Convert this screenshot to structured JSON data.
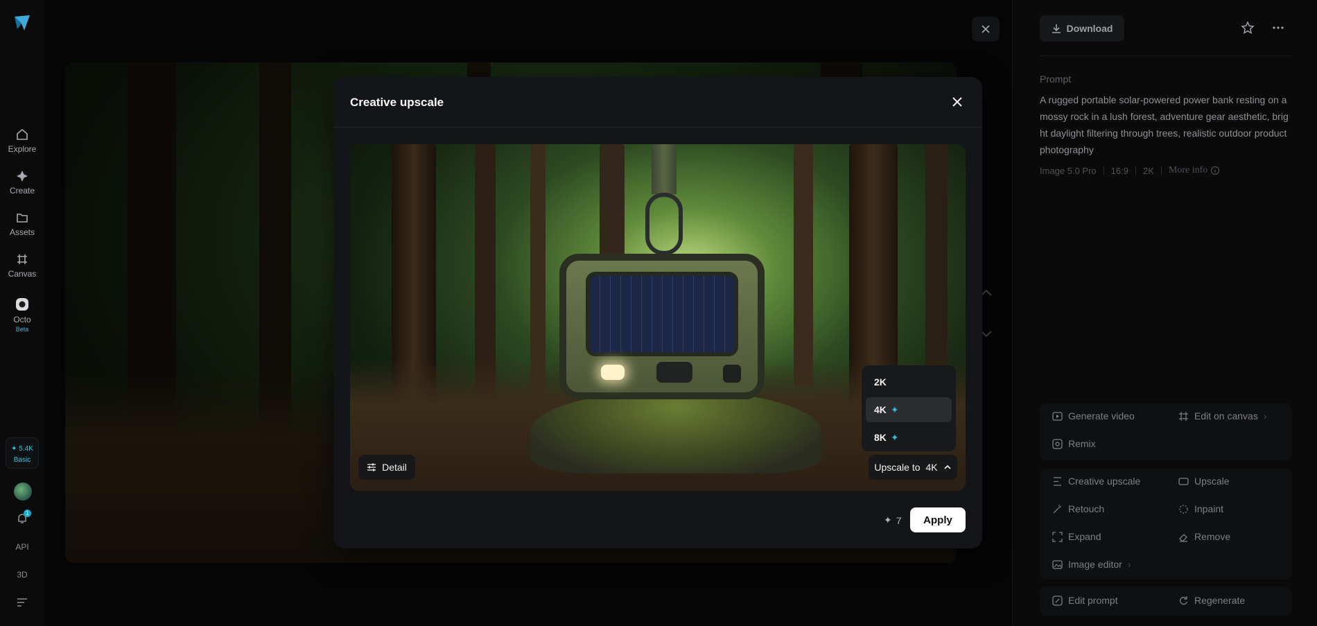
{
  "nav": {
    "items": [
      {
        "label": "Explore",
        "icon": "home-icon"
      },
      {
        "label": "Create",
        "icon": "sparkle-icon"
      },
      {
        "label": "Assets",
        "icon": "folder-icon"
      },
      {
        "label": "Canvas",
        "icon": "canvas-icon"
      },
      {
        "label": "Octo",
        "icon": "octo-icon",
        "badge": "Beta"
      }
    ],
    "credits": {
      "amount": "5.4K",
      "plan": "Basic"
    },
    "notification_count": "1",
    "bottom": [
      "API",
      "3D"
    ]
  },
  "right": {
    "download_label": "Download",
    "prompt_label": "Prompt",
    "prompt_text": "A rugged portable solar-powered power bank resting on a mossy rock in a lush forest, adventure gear aesthetic, bright daylight filtering through trees, realistic outdoor product photography",
    "meta": {
      "model": "Image 5.0 Pro",
      "ratio": "16:9",
      "resolution": "2K",
      "more_info": "More info"
    },
    "actions_group1": {
      "generate_video": "Generate video",
      "edit_on_canvas": "Edit on canvas",
      "remix": "Remix"
    },
    "actions_group2": {
      "creative_upscale": "Creative upscale",
      "upscale": "Upscale",
      "retouch": "Retouch",
      "inpaint": "Inpaint",
      "expand": "Expand",
      "remove": "Remove",
      "image_editor": "Image editor"
    },
    "actions_group3": {
      "edit_prompt": "Edit prompt",
      "regenerate": "Regenerate"
    }
  },
  "modal": {
    "title": "Creative upscale",
    "detail_label": "Detail",
    "upscale_prefix": "Upscale to",
    "upscale_value": "4K",
    "options": [
      {
        "label": "2K",
        "premium": false
      },
      {
        "label": "4K",
        "premium": true,
        "selected": true
      },
      {
        "label": "8K",
        "premium": true
      }
    ],
    "cost": "7",
    "apply_label": "Apply"
  },
  "colors": {
    "accent": "#37b6d6",
    "apply_bg": "#ffffff"
  }
}
